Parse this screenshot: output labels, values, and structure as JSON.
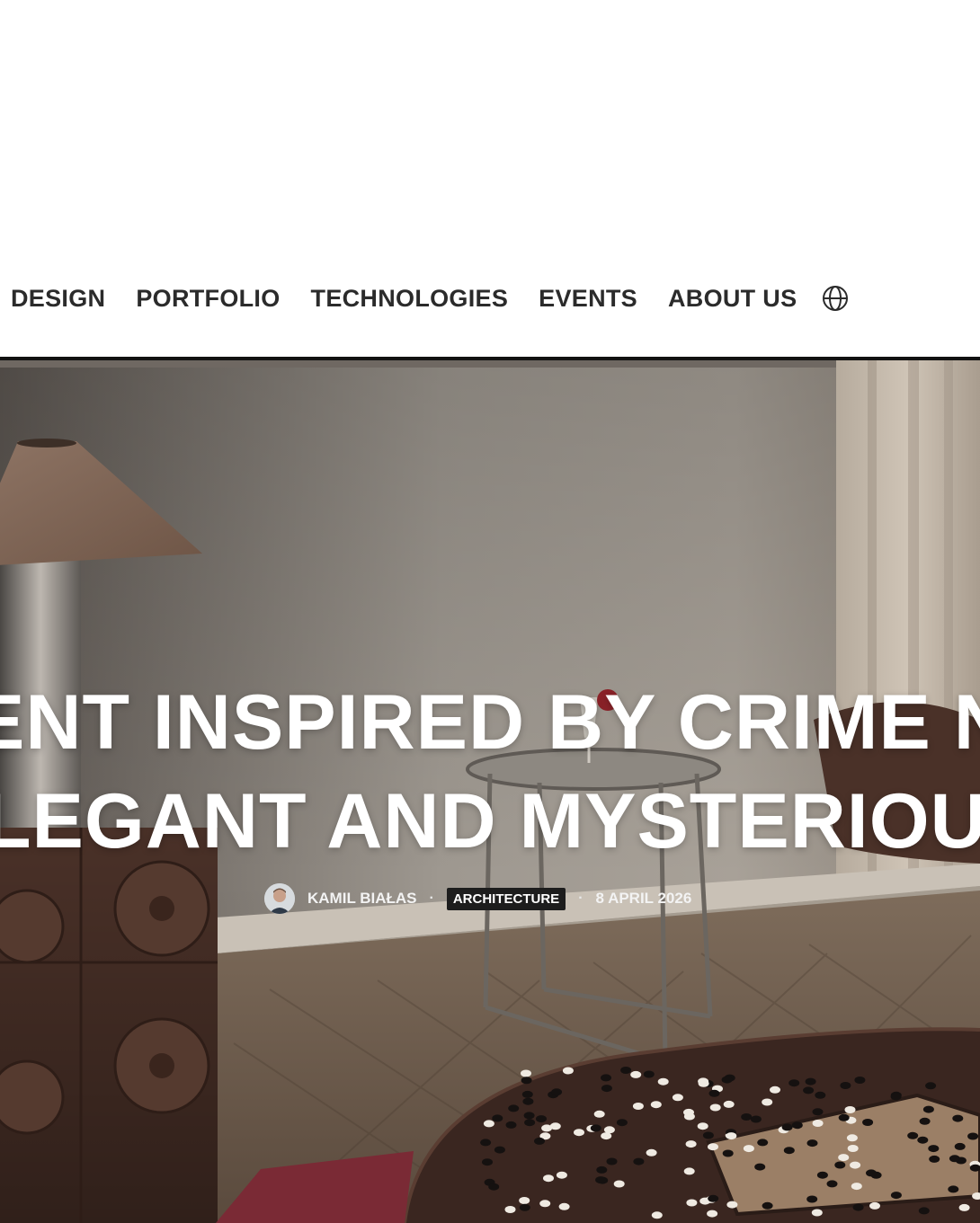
{
  "nav": {
    "items": [
      {
        "label": "DESIGN"
      },
      {
        "label": "PORTFOLIO"
      },
      {
        "label": "TECHNOLOGIES"
      },
      {
        "label": "EVENTS"
      },
      {
        "label": "ABOUT US"
      }
    ],
    "language_icon": "globe-icon"
  },
  "hero": {
    "headline_line1": "ENT INSPIRED BY CRIME N",
    "headline_line2": "LEGANT AND MYSTERIOU",
    "author": "KAMIL BIAŁAS",
    "category": "ARCHITECTURE",
    "date": "8 APRIL 2026",
    "separator": "·"
  },
  "colors": {
    "nav_text": "#2b2b2b",
    "divider": "#111111",
    "headline": "#ffffff",
    "badge_bg": "#1d1d1d"
  }
}
